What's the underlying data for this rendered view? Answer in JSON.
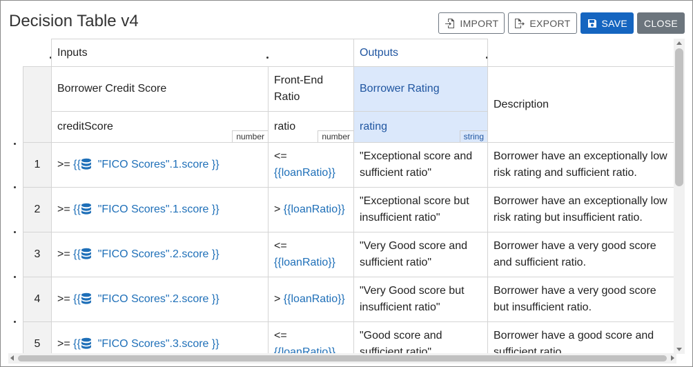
{
  "window": {
    "title": "Decision Table v4"
  },
  "toolbar": {
    "import_label": "IMPORT",
    "export_label": "EXPORT",
    "save_label": "SAVE",
    "close_label": "CLOSE"
  },
  "colors": {
    "primary": "#1565c0",
    "secondary": "#6c757d",
    "output_bg": "#dbe8fb",
    "output_text": "#1f55a0",
    "link": "#1e6fb8"
  },
  "table": {
    "groups": {
      "inputs": "Inputs",
      "outputs": "Outputs"
    },
    "columns": [
      {
        "header": "Borrower Credit Score",
        "variable": "creditScore",
        "type": "number"
      },
      {
        "header": "Front-End Ratio",
        "variable": "ratio",
        "type": "number"
      },
      {
        "header": "Borrower Rating",
        "variable": "rating",
        "type": "string"
      },
      {
        "header": "Description"
      }
    ],
    "rows": [
      {
        "num": "1",
        "op1": ">=",
        "ref1": "\"FICO Scores\".1.score }}",
        "op2": "<=",
        "ref2": "{{loanRatio}}",
        "rating": "\"Exceptional score and sufficient ratio\"",
        "desc1": "Borrower have an exceptionally low",
        "desc2": "risk rating and sufficient ratio."
      },
      {
        "num": "2",
        "op1": ">=",
        "ref1": "\"FICO Scores\".1.score }}",
        "op2": ">",
        "ref2": "{{loanRatio}}",
        "rating": "\"Exceptional score but insufficient ratio\"",
        "desc1": "Borrower have an exceptionally low",
        "desc2": "risk rating but insufficient ratio."
      },
      {
        "num": "3",
        "op1": ">=",
        "ref1": "\"FICO Scores\".2.score }}",
        "op2": "<=",
        "ref2": "{{loanRatio}}",
        "rating": "\"Very Good score and sufficient ratio\"",
        "desc1": "Borrower have a very good score",
        "desc2": "and sufficient ratio."
      },
      {
        "num": "4",
        "op1": ">=",
        "ref1": "\"FICO Scores\".2.score }}",
        "op2": ">",
        "ref2": "{{loanRatio}}",
        "rating": "\"Very Good score but insufficient ratio\"",
        "desc1": "Borrower have a very good score",
        "desc2": "but insufficient ratio."
      },
      {
        "num": "5",
        "op1": ">=",
        "ref1": "\"FICO Scores\".3.score }}",
        "op2": "<=",
        "ref2": "{{loanRatio}}",
        "rating": "\"Good score and sufficient ratio\"",
        "desc1": "Borrower have a good score and",
        "desc2": "sufficient ratio."
      }
    ]
  }
}
